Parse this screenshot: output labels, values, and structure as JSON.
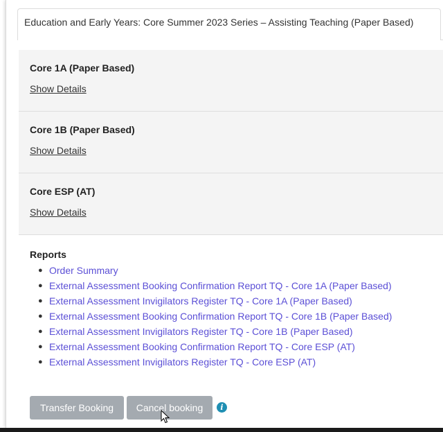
{
  "tab": {
    "title": "Education and Early Years: Core Summer 2023 Series – Assisting Teaching (Paper Based)"
  },
  "components": [
    {
      "title": "Core 1A (Paper Based)",
      "link": "Show Details"
    },
    {
      "title": "Core 1B (Paper Based)",
      "link": "Show Details"
    },
    {
      "title": "Core ESP (AT)",
      "link": "Show Details"
    }
  ],
  "reports": {
    "title": "Reports",
    "items": [
      "Order Summary",
      "External Assessment Booking Confirmation Report TQ - Core 1A (Paper Based)",
      "External Assessment Invigilators Register TQ - Core 1A (Paper Based)",
      "External Assessment Booking Confirmation Report TQ - Core 1B (Paper Based)",
      "External Assessment Invigilators Register TQ - Core 1B (Paper Based)",
      "External Assessment Booking Confirmation Report TQ - Core ESP (AT)",
      "External Assessment Invigilators Register TQ - Core ESP (AT)"
    ]
  },
  "actions": {
    "transfer_label": "Transfer Booking",
    "cancel_label": "Cancel booking",
    "info_icon": "info-icon"
  },
  "colors": {
    "link": "#5b4fd6",
    "button": "#a4aab0",
    "info": "#1f8fb3",
    "panel": "#f4f4f4"
  }
}
